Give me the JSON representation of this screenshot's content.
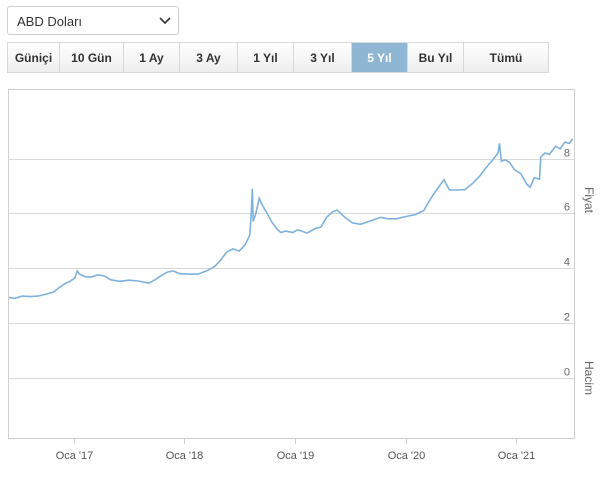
{
  "currency_select": {
    "selected": "ABD Doları"
  },
  "range_buttons": [
    {
      "label": "Güniçi",
      "active": false
    },
    {
      "label": "10 Gün",
      "active": false
    },
    {
      "label": "1 Ay",
      "active": false
    },
    {
      "label": "3 Ay",
      "active": false
    },
    {
      "label": "1 Yıl",
      "active": false
    },
    {
      "label": "3 Yıl",
      "active": false
    },
    {
      "label": "5 Yıl",
      "active": true
    },
    {
      "label": "Bu Yıl",
      "active": false
    },
    {
      "label": "Tümü",
      "active": false
    }
  ],
  "colors": {
    "line": "#7eb1dd",
    "active_button": "#8fb6d2",
    "grid": "#d9d9d9"
  },
  "chart_data": {
    "type": "line",
    "price_axis_label": "Fiyat",
    "volume_axis_label": "Hacim",
    "y_ticks": [
      0,
      2,
      4,
      6,
      8
    ],
    "ylim": [
      -2.2,
      10.5
    ],
    "xlim": [
      "2016-06-01",
      "2021-07-10"
    ],
    "x_ticks": [
      {
        "date": "2017-01-01",
        "label": "Oca '17"
      },
      {
        "date": "2018-01-01",
        "label": "Oca '18"
      },
      {
        "date": "2019-01-01",
        "label": "Oca '19"
      },
      {
        "date": "2020-01-01",
        "label": "Oca '20"
      },
      {
        "date": "2021-01-01",
        "label": "Oca '21"
      }
    ],
    "grid": true,
    "series": [
      {
        "points": [
          [
            "2016-06-01",
            2.93
          ],
          [
            "2016-06-20",
            2.9
          ],
          [
            "2016-07-15",
            2.98
          ],
          [
            "2016-08-10",
            2.96
          ],
          [
            "2016-09-05",
            2.98
          ],
          [
            "2016-10-01",
            3.05
          ],
          [
            "2016-10-25",
            3.12
          ],
          [
            "2016-11-15",
            3.3
          ],
          [
            "2016-12-05",
            3.45
          ],
          [
            "2016-12-20",
            3.52
          ],
          [
            "2017-01-05",
            3.65
          ],
          [
            "2017-01-12",
            3.9
          ],
          [
            "2017-01-20",
            3.78
          ],
          [
            "2017-02-10",
            3.68
          ],
          [
            "2017-03-01",
            3.68
          ],
          [
            "2017-03-20",
            3.75
          ],
          [
            "2017-04-10",
            3.72
          ],
          [
            "2017-05-01",
            3.58
          ],
          [
            "2017-06-01",
            3.52
          ],
          [
            "2017-07-01",
            3.56
          ],
          [
            "2017-08-01",
            3.53
          ],
          [
            "2017-09-05",
            3.45
          ],
          [
            "2017-09-25",
            3.57
          ],
          [
            "2017-10-15",
            3.72
          ],
          [
            "2017-11-05",
            3.85
          ],
          [
            "2017-11-25",
            3.9
          ],
          [
            "2017-12-15",
            3.8
          ],
          [
            "2018-01-15",
            3.78
          ],
          [
            "2018-02-15",
            3.78
          ],
          [
            "2018-03-15",
            3.9
          ],
          [
            "2018-04-10",
            4.05
          ],
          [
            "2018-05-01",
            4.3
          ],
          [
            "2018-05-20",
            4.58
          ],
          [
            "2018-06-10",
            4.7
          ],
          [
            "2018-07-01",
            4.62
          ],
          [
            "2018-07-20",
            4.85
          ],
          [
            "2018-08-05",
            5.2
          ],
          [
            "2018-08-10",
            6.1
          ],
          [
            "2018-08-13",
            6.9
          ],
          [
            "2018-08-16",
            5.7
          ],
          [
            "2018-08-25",
            6.0
          ],
          [
            "2018-09-05",
            6.55
          ],
          [
            "2018-09-15",
            6.3
          ],
          [
            "2018-10-01",
            6.0
          ],
          [
            "2018-10-15",
            5.7
          ],
          [
            "2018-11-01",
            5.45
          ],
          [
            "2018-11-15",
            5.3
          ],
          [
            "2018-12-01",
            5.35
          ],
          [
            "2018-12-25",
            5.3
          ],
          [
            "2019-01-10",
            5.4
          ],
          [
            "2019-02-10",
            5.28
          ],
          [
            "2019-03-10",
            5.45
          ],
          [
            "2019-03-28",
            5.5
          ],
          [
            "2019-04-15",
            5.85
          ],
          [
            "2019-05-05",
            6.05
          ],
          [
            "2019-05-20",
            6.12
          ],
          [
            "2019-06-15",
            5.85
          ],
          [
            "2019-07-10",
            5.65
          ],
          [
            "2019-08-05",
            5.6
          ],
          [
            "2019-09-01",
            5.7
          ],
          [
            "2019-10-10",
            5.85
          ],
          [
            "2019-11-05",
            5.8
          ],
          [
            "2019-12-01",
            5.8
          ],
          [
            "2020-01-10",
            5.9
          ],
          [
            "2020-02-01",
            5.95
          ],
          [
            "2020-03-01",
            6.1
          ],
          [
            "2020-03-25",
            6.55
          ],
          [
            "2020-04-15",
            6.9
          ],
          [
            "2020-05-07",
            7.22
          ],
          [
            "2020-05-25",
            6.85
          ],
          [
            "2020-06-15",
            6.85
          ],
          [
            "2020-07-15",
            6.86
          ],
          [
            "2020-08-10",
            7.1
          ],
          [
            "2020-09-01",
            7.35
          ],
          [
            "2020-09-25",
            7.7
          ],
          [
            "2020-10-15",
            7.95
          ],
          [
            "2020-11-01",
            8.2
          ],
          [
            "2020-11-06",
            8.55
          ],
          [
            "2020-11-12",
            7.9
          ],
          [
            "2020-11-25",
            7.95
          ],
          [
            "2020-12-10",
            7.85
          ],
          [
            "2020-12-25",
            7.6
          ],
          [
            "2021-01-15",
            7.45
          ],
          [
            "2021-02-05",
            7.05
          ],
          [
            "2021-02-15",
            6.95
          ],
          [
            "2021-03-01",
            7.3
          ],
          [
            "2021-03-18",
            7.25
          ],
          [
            "2021-03-22",
            8.05
          ],
          [
            "2021-04-05",
            8.2
          ],
          [
            "2021-04-20",
            8.15
          ],
          [
            "2021-05-10",
            8.45
          ],
          [
            "2021-05-25",
            8.35
          ],
          [
            "2021-06-10",
            8.6
          ],
          [
            "2021-06-25",
            8.55
          ],
          [
            "2021-07-05",
            8.72
          ]
        ]
      }
    ]
  }
}
